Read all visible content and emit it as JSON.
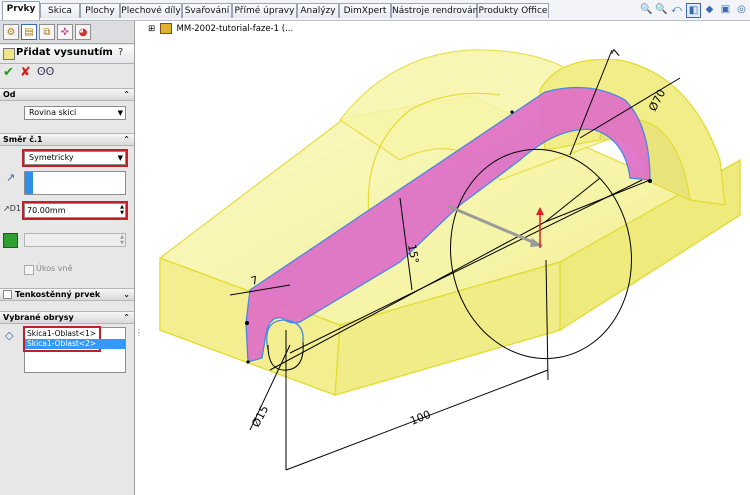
{
  "tabs": [
    "Prvky",
    "Skica",
    "Plochy",
    "Plechové díly",
    "Svařování",
    "Přímé úpravy",
    "Analýzy",
    "DimXpert",
    "Nástroje rendrování",
    "Produkty Office"
  ],
  "view_tools": [
    "zoom-to-fit-icon",
    "zoom-area-icon",
    "previous-view-icon",
    "section-view-icon",
    "display-style-icon",
    "view-orientation-icon",
    "hide-show-icon"
  ],
  "tree": {
    "expander": "⊞",
    "label": "MM-2002-tutorial-faze-1  (..."
  },
  "property_manager": {
    "title": "Přidat vysunutím",
    "help": "?",
    "from_section": {
      "label": "Od",
      "value": "Rovina skici"
    },
    "direction1": {
      "label": "Směr č.1",
      "end_condition": "Symetricky",
      "depth": "70.00mm",
      "draft_label": "Úkos vně"
    },
    "thin_feature": {
      "label": "Tenkostěnný prvek"
    },
    "selected_contours": {
      "label": "Vybrané obrysy",
      "items": [
        "Skica1-Oblast<1>",
        "Skica1-Oblast<2>"
      ]
    }
  },
  "dimensions": {
    "d1": "7",
    "d2": "Ø70",
    "d3": "15°",
    "d4": "7",
    "d5": "Ø15",
    "d6": "100"
  },
  "colors": {
    "model_yellow": "#f2ef88",
    "edge_yellow": "#e8e030",
    "sketch_pink": "#de6cc8",
    "selection": "#3399ff",
    "marker_red": "#c0202a"
  }
}
